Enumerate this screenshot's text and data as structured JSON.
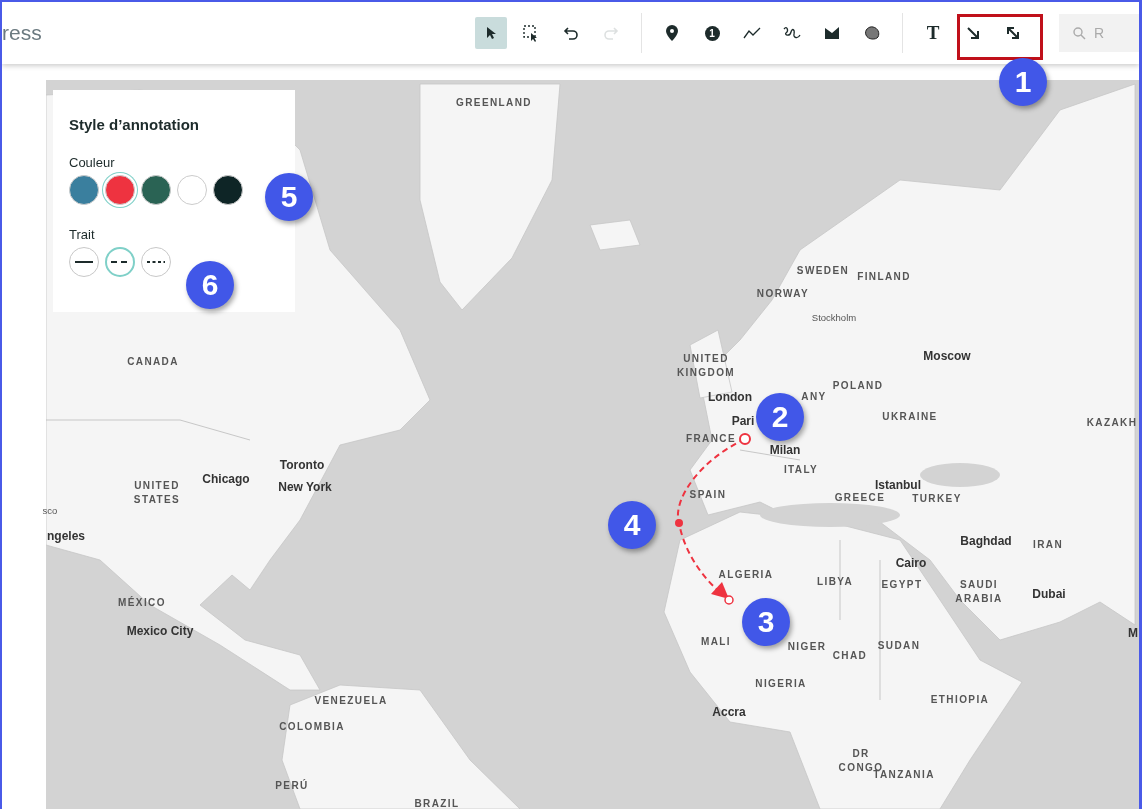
{
  "header": {
    "title": "ress"
  },
  "toolbar": {
    "groups": [
      [
        {
          "kind": "pointer",
          "selected": true,
          "disabled": false
        },
        {
          "kind": "marquee",
          "selected": false,
          "disabled": false
        },
        {
          "kind": "undo",
          "selected": false,
          "disabled": false
        },
        {
          "kind": "redo",
          "selected": false,
          "disabled": true
        }
      ],
      [
        {
          "kind": "pin",
          "selected": false,
          "disabled": false
        },
        {
          "kind": "number",
          "label": "1",
          "selected": false,
          "disabled": false
        },
        {
          "kind": "line",
          "selected": false,
          "disabled": false
        },
        {
          "kind": "freehand",
          "selected": false,
          "disabled": false
        },
        {
          "kind": "polygon",
          "selected": false,
          "disabled": false
        },
        {
          "kind": "blob",
          "selected": false,
          "disabled": false
        }
      ],
      [
        {
          "kind": "text",
          "label": "T",
          "selected": false,
          "disabled": false
        },
        {
          "kind": "arrow",
          "selected": false,
          "disabled": false
        },
        {
          "kind": "double-arrow",
          "selected": false,
          "disabled": false
        }
      ]
    ],
    "search": {
      "placeholder": "R"
    }
  },
  "style_panel": {
    "title": "Style d’annotation",
    "color_label": "Couleur",
    "colors": [
      {
        "color": "#3a7f9e",
        "selected": false
      },
      {
        "color": "#ee3340",
        "selected": true
      },
      {
        "color": "#2a6354",
        "selected": false
      },
      {
        "color": "#ffffff",
        "selected": false
      },
      {
        "color": "#0e2526",
        "selected": false
      }
    ],
    "stroke_label": "Trait",
    "strokes": [
      {
        "kind": "solid",
        "selected": false
      },
      {
        "kind": "dashed",
        "selected": true
      },
      {
        "kind": "dotted",
        "selected": false
      }
    ]
  },
  "map": {
    "labels": [
      {
        "text": "GREENLAND",
        "kind": "country"
      },
      {
        "text": "CANADA",
        "kind": "country"
      },
      {
        "text": "UNITED\nSTATES",
        "kind": "country"
      },
      {
        "text": "Toronto",
        "kind": "city"
      },
      {
        "text": "Chicago",
        "kind": "city"
      },
      {
        "text": "New York",
        "kind": "city"
      },
      {
        "text": "sco",
        "kind": "minor"
      },
      {
        "text": "ngeles",
        "kind": "city"
      },
      {
        "text": "MÉXICO",
        "kind": "country"
      },
      {
        "text": "Mexico City",
        "kind": "city"
      },
      {
        "text": "VENEZUELA",
        "kind": "country"
      },
      {
        "text": "COLOMBIA",
        "kind": "country"
      },
      {
        "text": "PERÚ",
        "kind": "country"
      },
      {
        "text": "BRAZIL",
        "kind": "country"
      },
      {
        "text": "SWEDEN",
        "kind": "country"
      },
      {
        "text": "FINLAND",
        "kind": "country"
      },
      {
        "text": "NORWAY",
        "kind": "country"
      },
      {
        "text": "Stockholm",
        "kind": "minor"
      },
      {
        "text": "UNITED\nKINGDOM",
        "kind": "country"
      },
      {
        "text": "London",
        "kind": "city"
      },
      {
        "text": "ANY",
        "kind": "country"
      },
      {
        "text": "POLAND",
        "kind": "country"
      },
      {
        "text": "Moscow",
        "kind": "city"
      },
      {
        "text": "Pari",
        "kind": "city"
      },
      {
        "text": "FRANCE",
        "kind": "country"
      },
      {
        "text": "UKRAINE",
        "kind": "country"
      },
      {
        "text": "KAZAKH",
        "kind": "country"
      },
      {
        "text": "Milan",
        "kind": "city"
      },
      {
        "text": "ITALY",
        "kind": "country"
      },
      {
        "text": "SPAIN",
        "kind": "country"
      },
      {
        "text": "Istanbul",
        "kind": "city"
      },
      {
        "text": "GREECE",
        "kind": "country"
      },
      {
        "text": "TURKEY",
        "kind": "country"
      },
      {
        "text": "Baghdad",
        "kind": "city"
      },
      {
        "text": "IRAN",
        "kind": "country"
      },
      {
        "text": "Cairo",
        "kind": "city"
      },
      {
        "text": "ALGERIA",
        "kind": "country"
      },
      {
        "text": "LIBYA",
        "kind": "country"
      },
      {
        "text": "EGYPT",
        "kind": "country"
      },
      {
        "text": "SAUDI\nARABIA",
        "kind": "country"
      },
      {
        "text": "Dubai",
        "kind": "city"
      },
      {
        "text": "M",
        "kind": "city"
      },
      {
        "text": "MALI",
        "kind": "country"
      },
      {
        "text": "NIGER",
        "kind": "country"
      },
      {
        "text": "CHAD",
        "kind": "country"
      },
      {
        "text": "SUDAN",
        "kind": "country"
      },
      {
        "text": "NIGERIA",
        "kind": "country"
      },
      {
        "text": "ETHIOPIA",
        "kind": "country"
      },
      {
        "text": "Accra",
        "kind": "city"
      },
      {
        "text": "DR\nCONGO",
        "kind": "country"
      },
      {
        "text": "TANZANIA",
        "kind": "country"
      }
    ]
  },
  "callouts": [
    "1",
    "2",
    "3",
    "4",
    "5",
    "6"
  ]
}
